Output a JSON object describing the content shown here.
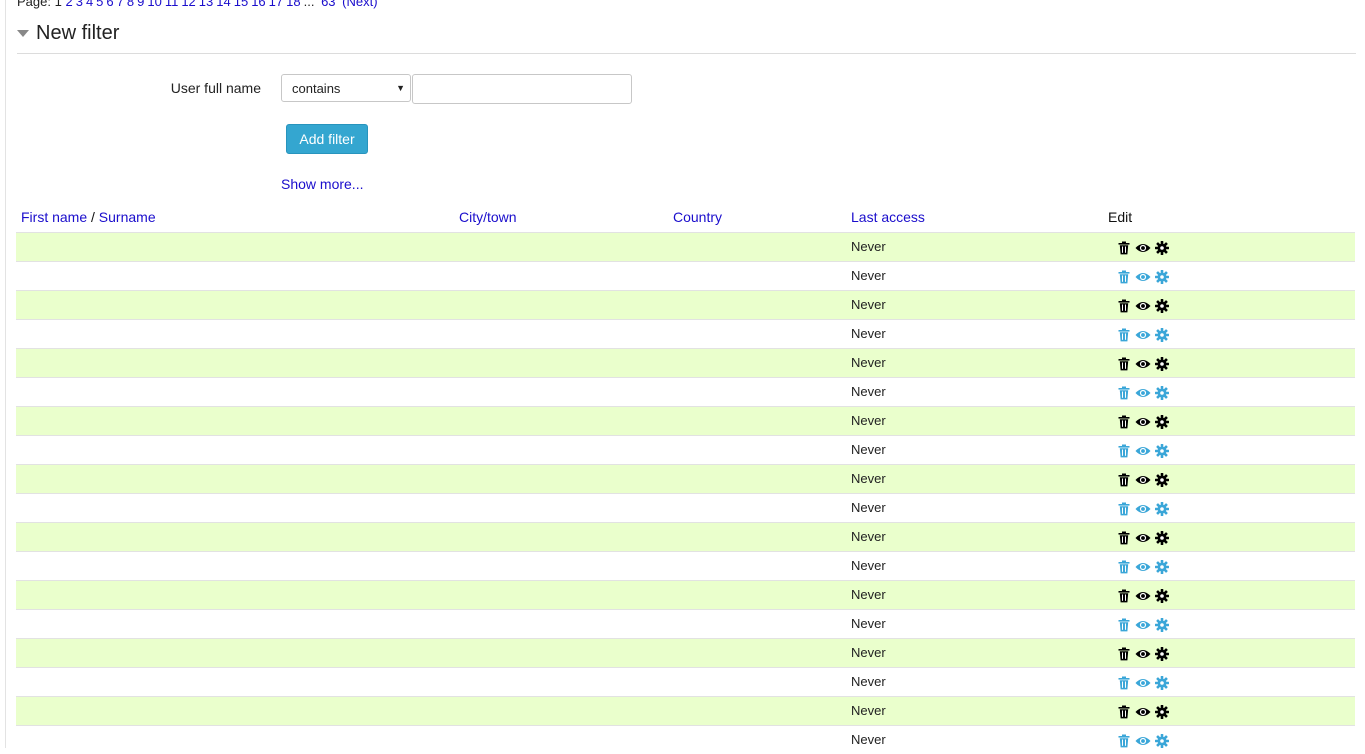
{
  "pager": {
    "label": "Page:",
    "current": "1",
    "pages": [
      "2",
      "3",
      "4",
      "5",
      "6",
      "7",
      "8",
      "9",
      "10",
      "11",
      "12",
      "13",
      "14",
      "15",
      "16",
      "17",
      "18"
    ],
    "ellipsis": "...",
    "last": "63",
    "next": "(Next)"
  },
  "filter": {
    "section_title": "New filter",
    "field_label": "User full name",
    "operator_value": "contains",
    "text_value": "",
    "add_button": "Add filter",
    "show_more": "Show more..."
  },
  "table": {
    "headers": {
      "first_name": "First name",
      "separator": " / ",
      "surname": "Surname",
      "city": "City/town",
      "country": "Country",
      "last_access": "Last access",
      "edit": "Edit"
    },
    "rows": [
      {
        "last_access": "Never",
        "icon_color": "#000000"
      },
      {
        "last_access": "Never",
        "icon_color": "#3aa6d8"
      },
      {
        "last_access": "Never",
        "icon_color": "#000000"
      },
      {
        "last_access": "Never",
        "icon_color": "#3aa6d8"
      },
      {
        "last_access": "Never",
        "icon_color": "#000000"
      },
      {
        "last_access": "Never",
        "icon_color": "#3aa6d8"
      },
      {
        "last_access": "Never",
        "icon_color": "#000000"
      },
      {
        "last_access": "Never",
        "icon_color": "#3aa6d8"
      },
      {
        "last_access": "Never",
        "icon_color": "#000000"
      },
      {
        "last_access": "Never",
        "icon_color": "#3aa6d8"
      },
      {
        "last_access": "Never",
        "icon_color": "#000000"
      },
      {
        "last_access": "Never",
        "icon_color": "#3aa6d8"
      },
      {
        "last_access": "Never",
        "icon_color": "#000000"
      },
      {
        "last_access": "Never",
        "icon_color": "#3aa6d8"
      },
      {
        "last_access": "Never",
        "icon_color": "#000000"
      },
      {
        "last_access": "Never",
        "icon_color": "#3aa6d8"
      },
      {
        "last_access": "Never",
        "icon_color": "#000000"
      },
      {
        "last_access": "Never",
        "icon_color": "#3aa6d8"
      }
    ],
    "row_icons": [
      "trash-icon",
      "eye-icon",
      "gear-icon"
    ]
  },
  "colors": {
    "link": "#1a0dcc",
    "button": "#34a6d0",
    "row_highlight": "#eaffcc"
  }
}
